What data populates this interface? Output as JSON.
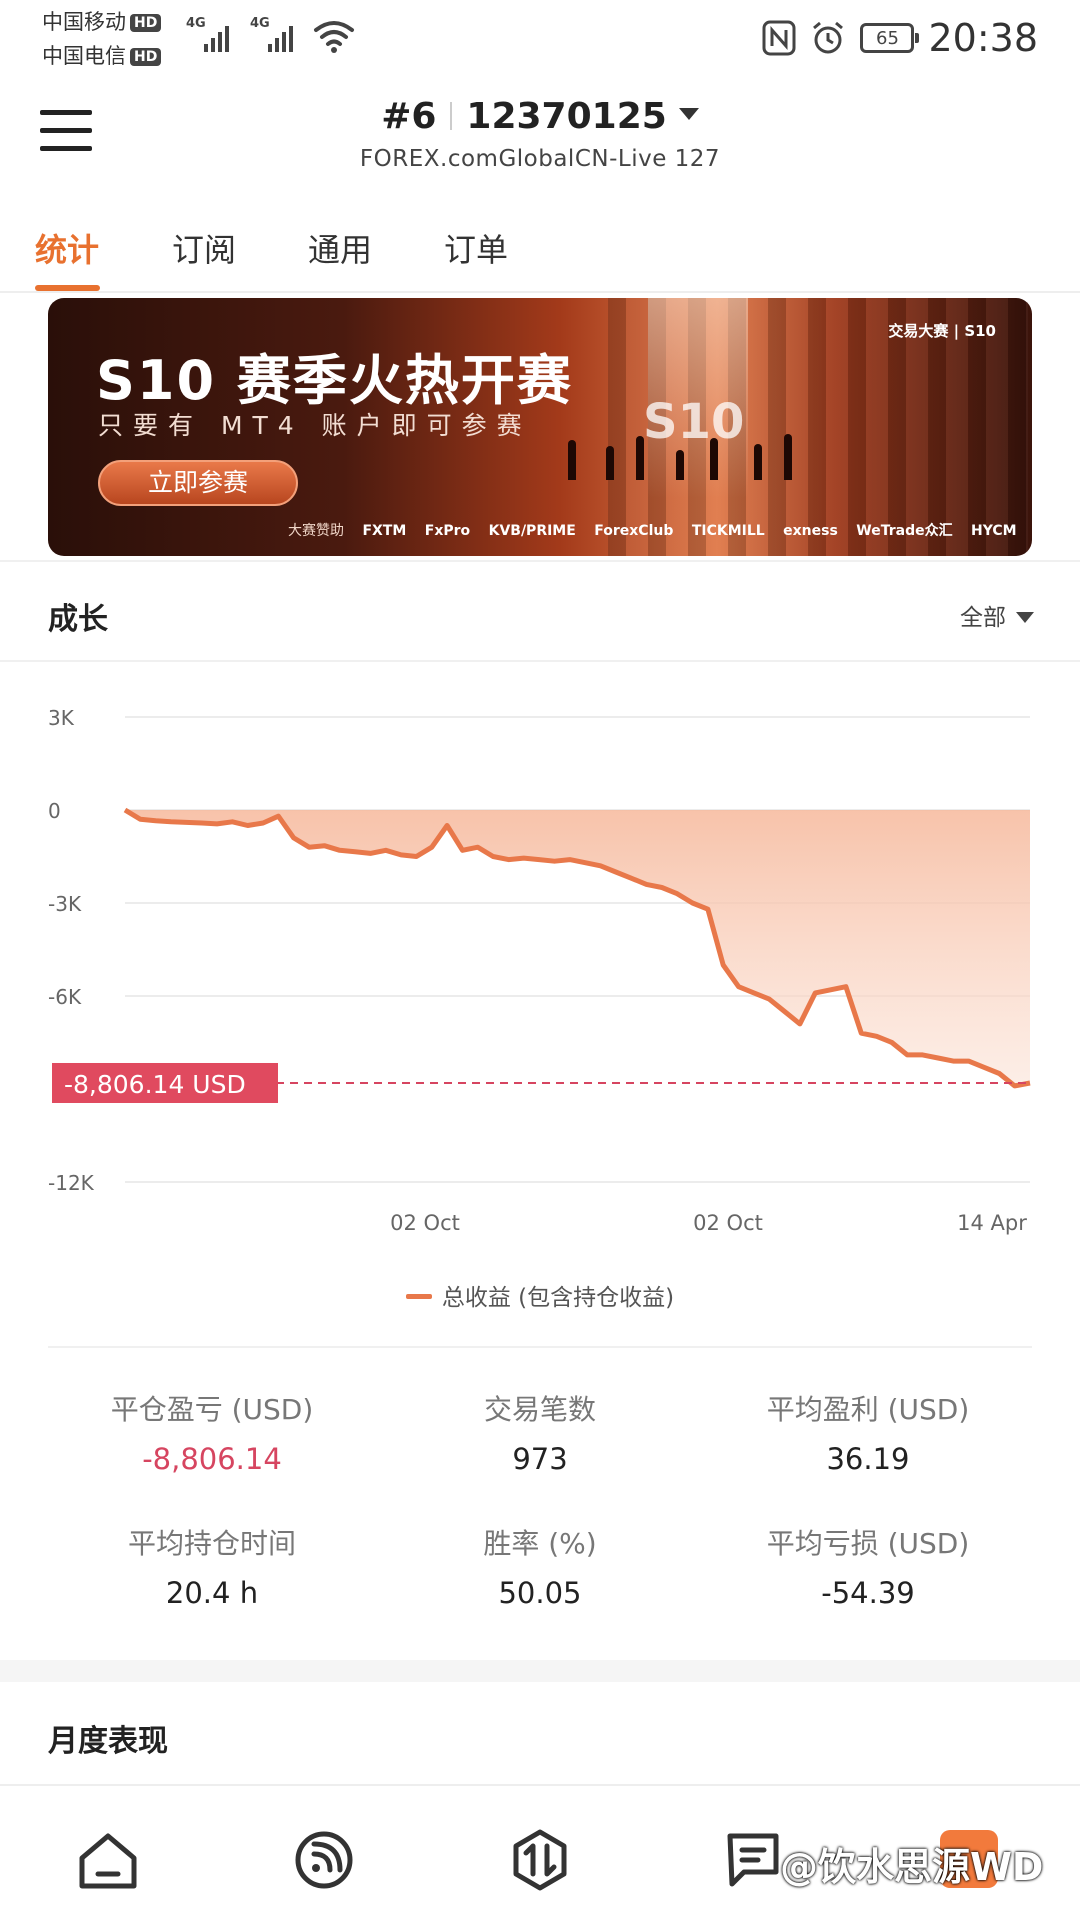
{
  "status_bar": {
    "carrier1": "中国移动",
    "carrier2": "中国电信",
    "hd": "HD",
    "net1": "4G",
    "net2": "4G",
    "battery": "65",
    "time": "20:38"
  },
  "header": {
    "rank": "#6",
    "account": "12370125",
    "server": "FOREX.comGlobalCN-Live 127"
  },
  "tabs": [
    "统计",
    "订阅",
    "通用",
    "订单"
  ],
  "banner": {
    "title": "S10 赛季火热开赛",
    "subtitle": "只要有 MT4 账户即可参赛",
    "button": "立即参赛",
    "brand": "交易大赛 | S10",
    "big_logo": "S10",
    "sponsor_label": "大赛赞助",
    "sponsors": [
      "FXTM",
      "FxPro",
      "KVB/PRIME",
      "ForexClub",
      "TICKMILL",
      "exness",
      "WeTrade众汇",
      "HYCM"
    ]
  },
  "growth": {
    "title": "成长",
    "filter": "全部",
    "current_label": "-8,806.14 USD",
    "legend": "总收益 (包含持仓收益)"
  },
  "chart_data": {
    "type": "area",
    "y_ticks": [
      "3K",
      "0",
      "-3K",
      "-6K",
      "-12K"
    ],
    "x_ticks": [
      "02 Oct",
      "02 Oct",
      "14 Apr"
    ],
    "ylim": [
      -12000,
      3000
    ],
    "series": [
      {
        "name": "总收益 (包含持仓收益)",
        "values": [
          0,
          -300,
          -350,
          -380,
          -400,
          -420,
          -450,
          -380,
          -500,
          -420,
          -200,
          -900,
          -1200,
          -1150,
          -1300,
          -1350,
          -1400,
          -1300,
          -1450,
          -1500,
          -1200,
          -500,
          -1300,
          -1200,
          -1500,
          -1600,
          -1550,
          -1600,
          -1650,
          -1600,
          -1700,
          -1800,
          -2000,
          -2200,
          -2400,
          -2500,
          -2700,
          -3000,
          -3200,
          -5000,
          -5700,
          -5900,
          -6100,
          -6500,
          -6900,
          -5900,
          -5800,
          -5700,
          -7200,
          -7300,
          -7500,
          -7900,
          -7900,
          -8000,
          -8100,
          -8100,
          -8300,
          -8500,
          -8900,
          -8806
        ]
      }
    ],
    "reference_line": -8806.14,
    "fill_color": "#f7c7b0",
    "line_color": "#e8784a"
  },
  "stats": [
    {
      "label": "平仓盈亏 (USD)",
      "value": "-8,806.14",
      "negative": true
    },
    {
      "label": "交易笔数",
      "value": "973",
      "negative": false
    },
    {
      "label": "平均盈利 (USD)",
      "value": "36.19",
      "negative": false
    },
    {
      "label": "平均持仓时间",
      "value": "20.4 h",
      "negative": false
    },
    {
      "label": "胜率 (%)",
      "value": "50.05",
      "negative": false
    },
    {
      "label": "平均亏损 (USD)",
      "value": "-54.39",
      "negative": false
    }
  ],
  "monthly": {
    "title": "月度表现"
  },
  "watermark": "@饮水思源WD",
  "colors": {
    "accent": "#e8712f",
    "negative": "#d64560",
    "line": "#e8784a"
  }
}
